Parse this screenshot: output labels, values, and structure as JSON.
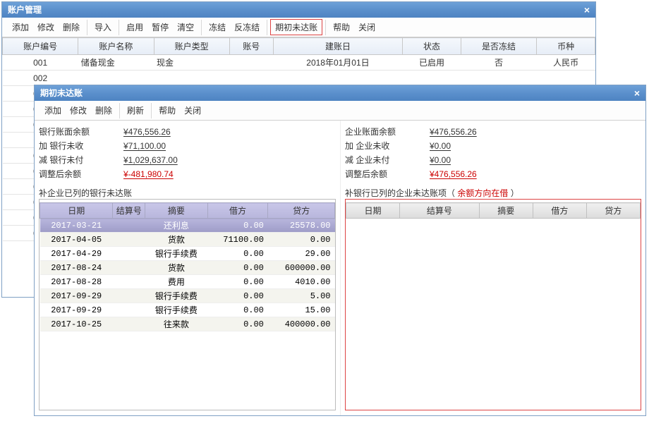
{
  "mainWindow": {
    "title": "账户管理",
    "toolbar": [
      [
        "添加",
        "修改",
        "删除"
      ],
      [
        "导入"
      ],
      [
        "启用",
        "暂停",
        "清空"
      ],
      [
        "冻结",
        "反冻结"
      ],
      [
        "期初未达账"
      ],
      [
        "帮助",
        "关闭"
      ]
    ],
    "highlightBtn": "期初未达账",
    "columns": [
      "账户编号",
      "账户名称",
      "账户类型",
      "账号",
      "建账日",
      "状态",
      "是否冻结",
      "币种"
    ],
    "rows": [
      {
        "code": "001",
        "name": "储备现金",
        "type": "现金",
        "acct": "",
        "date": "2018年01月01日",
        "status": "已启用",
        "frozen": "否",
        "currency": "人民币"
      },
      {
        "code": "002"
      },
      {
        "code": "003"
      },
      {
        "code": "009"
      },
      {
        "code": "010"
      },
      {
        "code": "011"
      },
      {
        "code": "012"
      },
      {
        "code": "013"
      },
      {
        "code": "014"
      },
      {
        "code": "015"
      },
      {
        "code": "016"
      },
      {
        "code": "017"
      }
    ]
  },
  "dialog": {
    "title": "期初未达账",
    "toolbar": [
      [
        "添加",
        "修改",
        "删除"
      ],
      [
        "刷新"
      ],
      [
        "帮助",
        "关闭"
      ]
    ],
    "left": {
      "summary": [
        {
          "label": "银行账面余额",
          "value": "¥476,556.26"
        },
        {
          "label": "加 银行未收",
          "value": "¥71,100.00"
        },
        {
          "label": "减 银行未付",
          "value": "¥1,029,637.00"
        },
        {
          "label": "调整后余额",
          "value": "¥-481,980.74",
          "red": true
        }
      ],
      "caption": "补企业已列的银行未达账",
      "columns": [
        "日期",
        "结算号",
        "摘要",
        "借方",
        "贷方"
      ],
      "rows": [
        {
          "date": "2017-03-21",
          "no": "",
          "summary": "还利息",
          "debit": "0.00",
          "credit": "25578.00",
          "selected": true
        },
        {
          "date": "2017-04-05",
          "no": "",
          "summary": "货款",
          "debit": "71100.00",
          "credit": "0.00"
        },
        {
          "date": "2017-04-29",
          "no": "",
          "summary": "银行手续费",
          "debit": "0.00",
          "credit": "29.00"
        },
        {
          "date": "2017-08-24",
          "no": "",
          "summary": "货款",
          "debit": "0.00",
          "credit": "600000.00"
        },
        {
          "date": "2017-08-28",
          "no": "",
          "summary": "费用",
          "debit": "0.00",
          "credit": "4010.00"
        },
        {
          "date": "2017-09-29",
          "no": "",
          "summary": "银行手续费",
          "debit": "0.00",
          "credit": "5.00"
        },
        {
          "date": "2017-09-29",
          "no": "",
          "summary": "银行手续费",
          "debit": "0.00",
          "credit": "15.00"
        },
        {
          "date": "2017-10-25",
          "no": "",
          "summary": "往来款",
          "debit": "0.00",
          "credit": "400000.00"
        }
      ]
    },
    "right": {
      "summary": [
        {
          "label": "企业账面余额",
          "value": "¥476,556.26"
        },
        {
          "label": "加 企业未收",
          "value": "¥0.00"
        },
        {
          "label": "减 企业未付",
          "value": "¥0.00"
        },
        {
          "label": "调整后余额",
          "value": "¥476,556.26",
          "red": true
        }
      ],
      "caption": "补银行已列的企业未达账项（",
      "captionRed": "余额方向在借",
      "captionTail": "  ）",
      "columns": [
        "日期",
        "结算号",
        "摘要",
        "借方",
        "贷方"
      ],
      "rows": []
    }
  }
}
